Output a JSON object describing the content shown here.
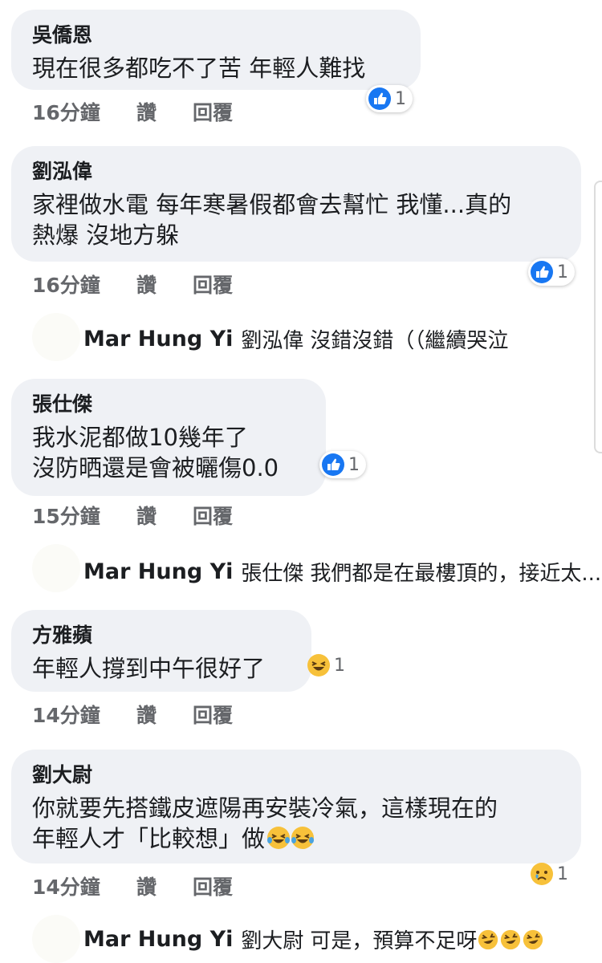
{
  "meta_labels": {
    "like": "讚",
    "reply": "回覆"
  },
  "comments": [
    {
      "name": "吳僑恩",
      "text": "現在很多都吃不了苦 年輕人難找",
      "time": "16分鐘",
      "reaction": {
        "type": "like",
        "count": "1"
      }
    },
    {
      "name": "劉泓偉",
      "text": "家裡做水電 每年寒暑假都會去幫忙 我懂...真的\n熱爆 沒地方躲",
      "time": "16分鐘",
      "reaction": {
        "type": "like",
        "count": "1"
      },
      "reply": {
        "author": "Mar Hung Yi",
        "tag": "劉泓偉",
        "text": "沒錯沒錯（（繼續哭泣"
      }
    },
    {
      "name": "張仕傑",
      "text": "我水泥都做10幾年了\n沒防晒還是會被曬傷0.0",
      "time": "15分鐘",
      "reaction": {
        "type": "like",
        "count": "1"
      },
      "reply": {
        "author": "Mar Hung Yi",
        "tag": "張仕傑",
        "text": "我們都是在最樓頂的，接近太..."
      }
    },
    {
      "name": "方雅蘋",
      "text": "年輕人撐到中午很好了",
      "time": "14分鐘",
      "reaction": {
        "type": "haha",
        "count": "1"
      }
    },
    {
      "name": "劉大尉",
      "text": "你就要先搭鐵皮遮陽再安裝冷氣，這樣現在的\n年輕人才「比較想」做",
      "time": "14分鐘",
      "reaction": {
        "type": "sad",
        "count": "1"
      },
      "reply": {
        "author": "Mar Hung Yi",
        "tag": "劉大尉",
        "text": "可是，預算不足呀"
      }
    }
  ],
  "colors": {
    "bubble": "#eff1f5",
    "like_blue": "#1877f2",
    "emoji_yellow": "#f7c13a",
    "meta_gray": "#65676b"
  }
}
